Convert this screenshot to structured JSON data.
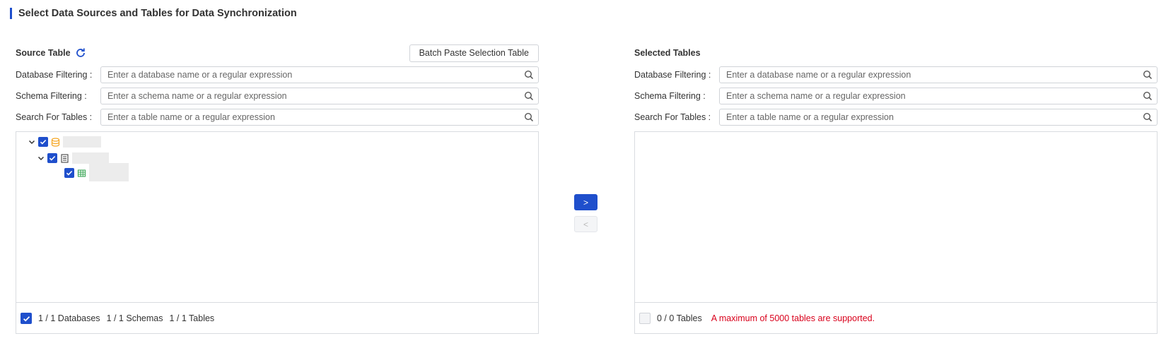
{
  "title": "Select Data Sources and Tables for Data Synchronization",
  "source": {
    "label": "Source Table",
    "batch_button": "Batch Paste Selection Table",
    "filters": [
      {
        "label": "Database Filtering :",
        "placeholder": "Enter a database name or a regular expression"
      },
      {
        "label": "Schema Filtering :",
        "placeholder": "Enter a schema name or a regular expression"
      },
      {
        "label": "Search For Tables :",
        "placeholder": "Enter a table name or a regular expression"
      }
    ],
    "tree": {
      "database": {
        "checked": true,
        "expanded": true,
        "icon": "database-icon"
      },
      "schema": {
        "checked": true,
        "expanded": true,
        "icon": "schema-icon"
      },
      "table": {
        "checked": true,
        "icon": "table-icon"
      }
    },
    "footer": {
      "select_all_checked": true,
      "databases": "1 / 1 Databases",
      "schemas": "1 / 1 Schemas",
      "tables": "1 / 1 Tables"
    }
  },
  "transfer": {
    "move_right_label": ">",
    "move_left_label": "<"
  },
  "selected": {
    "label": "Selected Tables",
    "filters": [
      {
        "label": "Database Filtering :",
        "placeholder": "Enter a database name or a regular expression"
      },
      {
        "label": "Schema Filtering :",
        "placeholder": "Enter a schema name or a regular expression"
      },
      {
        "label": "Search For Tables :",
        "placeholder": "Enter a table name or a regular expression"
      }
    ],
    "footer": {
      "select_all_checked": false,
      "tables": "0 / 0 Tables",
      "warning": "A maximum of 5000 tables are supported."
    }
  },
  "colors": {
    "accent": "#1f4fcc",
    "warning": "#d9001b",
    "database_icon": "#f5a623",
    "table_icon": "#3aa655"
  }
}
